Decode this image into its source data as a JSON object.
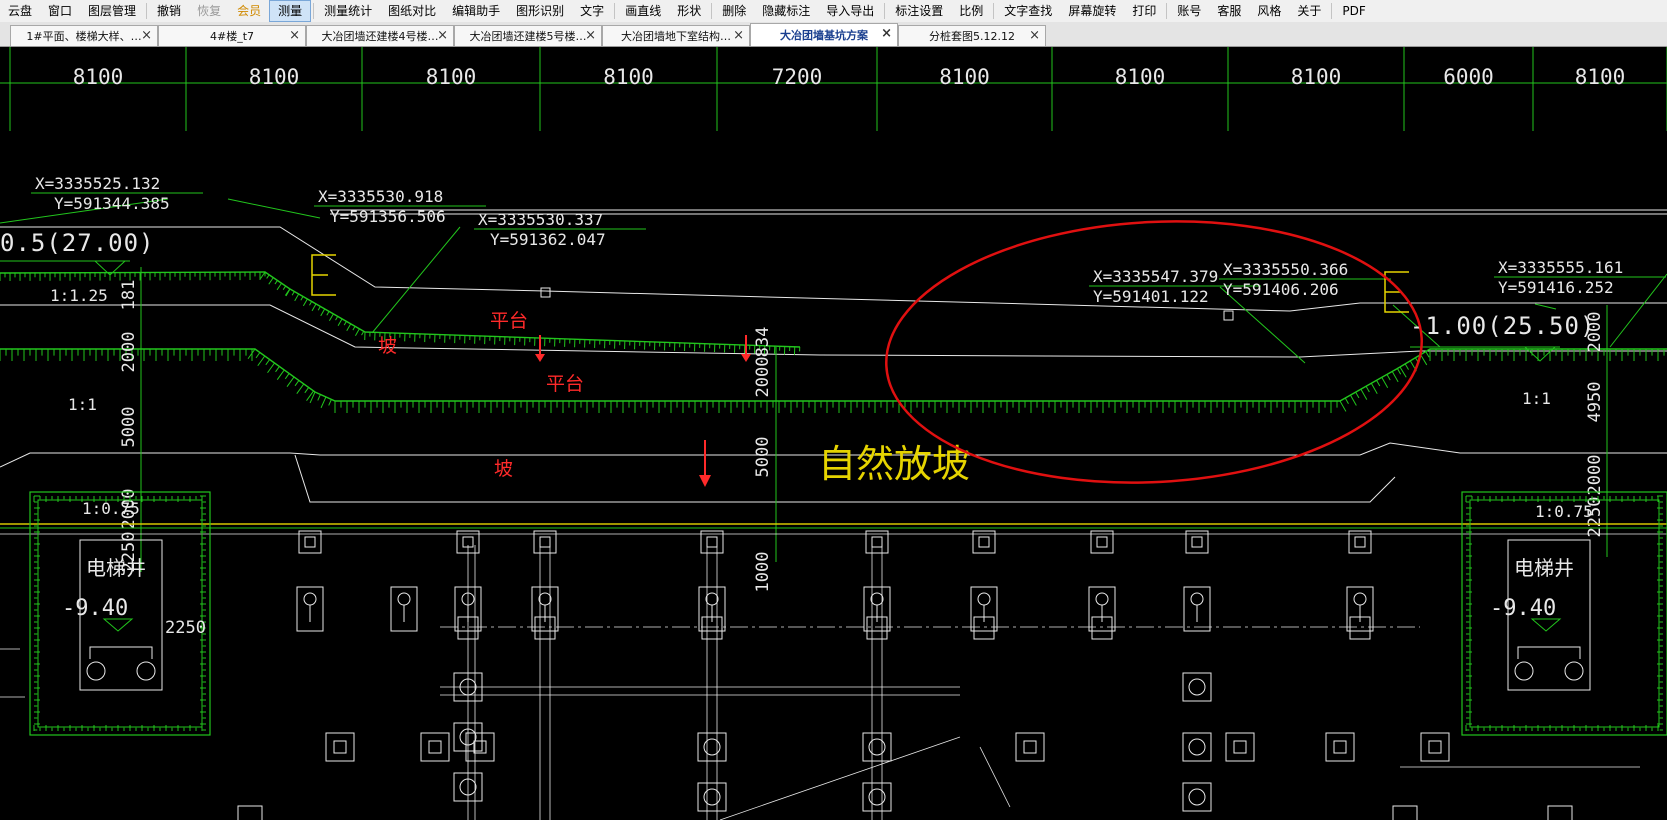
{
  "menu": [
    "云盘",
    "窗口",
    "图层管理",
    "撤销",
    "恢复",
    "会员",
    "测量",
    "测量统计",
    "图纸对比",
    "编辑助手",
    "图形识别",
    "文字",
    "画直线",
    "形状",
    "删除",
    "隐藏标注",
    "导入导出",
    "标注设置",
    "比例",
    "文字查找",
    "屏幕旋转",
    "打印",
    "账号",
    "客服",
    "风格",
    "关于",
    "PDF"
  ],
  "tabs": [
    {
      "label": "1#平面、楼梯大样、…",
      "active": false
    },
    {
      "label": "4#楼_t7",
      "active": false
    },
    {
      "label": "大冶团墙还建楼4号楼…",
      "active": false
    },
    {
      "label": "大冶团墙还建楼5号楼…",
      "active": false
    },
    {
      "label": "大冶团墙地下室结构…",
      "active": false
    },
    {
      "label": "大冶团墙基坑方案",
      "active": true
    },
    {
      "label": "分桩套图5.12.12",
      "active": false
    }
  ],
  "tab_close_symbol": "×",
  "drawing": {
    "grid_dims": [
      "8100",
      "8100",
      "8100",
      "8100",
      "7200",
      "8100",
      "8100",
      "8100",
      "6000",
      "8100"
    ],
    "coords": [
      {
        "x": "X=3335525.132",
        "y": "Y=591344.385"
      },
      {
        "x": "X=3335530.918",
        "y": "Y=591356.506"
      },
      {
        "x": "X=3335530.337",
        "y": "Y=591362.047"
      },
      {
        "x": "X=3335547.379",
        "y": "Y=591401.122"
      },
      {
        "x": "X=3335550.366",
        "y": "Y=591406.206"
      },
      {
        "x": "X=3335555.161",
        "y": "Y=591416.252"
      }
    ],
    "left_level": "0.5(27.00)",
    "right_level": "-1.00(25.50)",
    "slope_ratios": [
      "1:1.25",
      "1:1",
      "1:0.75",
      "1:1",
      "1:0.75"
    ],
    "left_dims": [
      "181",
      "2000",
      "5000",
      "2000",
      "2250"
    ],
    "mid_dims": [
      "834",
      "2000",
      "5000",
      "1000"
    ],
    "right_dims": [
      "2000",
      "4950",
      "2000",
      "2250"
    ],
    "dim_2250": "2250",
    "elevator_label": "电梯井",
    "elevator_level": "-9.40",
    "red_labels": [
      "坡",
      "平台",
      "平台",
      "坡"
    ],
    "natural_slope": "自然放坡",
    "section_mark": "F"
  },
  "colors": {
    "background": "#000000",
    "green": "#22c51d",
    "white": "#e8e8e8",
    "red_label": "#ff2a2a",
    "yellow_label": "#e6d400",
    "yellow_line": "#d6c800",
    "circle": "#e01010",
    "tab_active_text": "#1a3f8f",
    "menu_vip": "#d08a00"
  }
}
